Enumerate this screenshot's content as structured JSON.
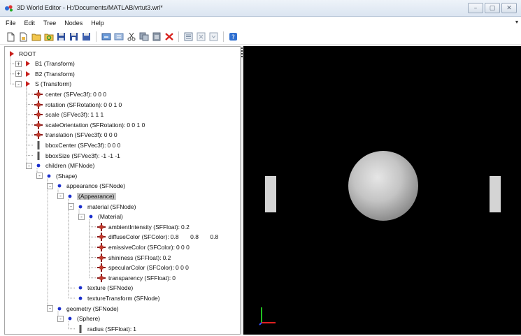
{
  "window": {
    "title": "3D World Editor - H:/Documents/MATLAB/vrtut3.wrl*",
    "controls": [
      "minimize",
      "maximize",
      "close"
    ]
  },
  "menu": [
    "File",
    "Edit",
    "Tree",
    "Nodes",
    "Help"
  ],
  "toolbar": {
    "buttons": [
      "new-file-icon",
      "open-file-icon",
      "open-folder-icon",
      "reload-icon",
      "save-icon",
      "save-as-icon",
      "save-copy-icon",
      "undo-icon",
      "redo-icon",
      "cut-icon",
      "copy-icon",
      "paste-icon",
      "delete-icon",
      "expand-icon",
      "collapse-icon",
      "collapse-all-icon",
      "help-icon"
    ]
  },
  "tree": {
    "rows": [
      {
        "label": "ROOT",
        "value": "",
        "kind": "root",
        "depth": 0,
        "expander": "",
        "selected": false
      },
      {
        "label": "B1 (Transform)",
        "value": "",
        "kind": "node",
        "depth": 1,
        "expander": "+",
        "selected": false
      },
      {
        "label": "B2 (Transform)",
        "value": "",
        "kind": "node",
        "depth": 1,
        "expander": "+",
        "selected": false
      },
      {
        "label": "S (Transform)",
        "value": "",
        "kind": "node",
        "depth": 1,
        "expander": "-",
        "selected": false
      },
      {
        "label": "center (SFVec3f):",
        "value": "0 0 0",
        "kind": "field",
        "depth": 2,
        "expander": "",
        "selected": false
      },
      {
        "label": "rotation (SFRotation):",
        "value": "0 0 1 0",
        "kind": "field",
        "depth": 2,
        "expander": "",
        "selected": false
      },
      {
        "label": "scale (SFVec3f):",
        "value": "1 1 1",
        "kind": "field",
        "depth": 2,
        "expander": "",
        "selected": false
      },
      {
        "label": "scaleOrientation (SFRotation):",
        "value": "0 0 1 0",
        "kind": "field",
        "depth": 2,
        "expander": "",
        "selected": false
      },
      {
        "label": "translation (SFVec3f):",
        "value": "0 0 0",
        "kind": "field",
        "depth": 2,
        "expander": "",
        "selected": false
      },
      {
        "label": "bboxCenter (SFVec3f):",
        "value": "0 0 0",
        "kind": "bbox",
        "depth": 2,
        "expander": "",
        "selected": false
      },
      {
        "label": "bboxSize (SFVec3f):",
        "value": "-1 -1 -1",
        "kind": "bbox",
        "depth": 2,
        "expander": "",
        "selected": false
      },
      {
        "label": "children (MFNode)",
        "value": "",
        "kind": "slot",
        "depth": 2,
        "expander": "-",
        "selected": false
      },
      {
        "label": "(Shape)",
        "value": "",
        "kind": "slot",
        "depth": 3,
        "expander": "-",
        "selected": false
      },
      {
        "label": "appearance (SFNode)",
        "value": "",
        "kind": "slot",
        "depth": 4,
        "expander": "-",
        "selected": false
      },
      {
        "label": "(Appearance)",
        "value": "",
        "kind": "slot",
        "depth": 5,
        "expander": "-",
        "selected": true
      },
      {
        "label": "material (SFNode)",
        "value": "",
        "kind": "slot",
        "depth": 6,
        "expander": "-",
        "selected": false
      },
      {
        "label": "(Material)",
        "value": "",
        "kind": "slot",
        "depth": 7,
        "expander": "-",
        "selected": false
      },
      {
        "label": "ambientIntensity (SFFloat):",
        "value": "0.2",
        "kind": "field",
        "depth": 8,
        "expander": "",
        "selected": false
      },
      {
        "label": "diffuseColor (SFColor):",
        "value": "0.8       0.8       0.8",
        "kind": "field",
        "depth": 8,
        "expander": "",
        "selected": false
      },
      {
        "label": "emissiveColor (SFColor):",
        "value": "0 0 0",
        "kind": "field",
        "depth": 8,
        "expander": "",
        "selected": false
      },
      {
        "label": "shininess (SFFloat):",
        "value": "0.2",
        "kind": "field",
        "depth": 8,
        "expander": "",
        "selected": false
      },
      {
        "label": "specularColor (SFColor):",
        "value": "0 0 0",
        "kind": "field",
        "depth": 8,
        "expander": "",
        "selected": false
      },
      {
        "label": "transparency (SFFloat):",
        "value": "0",
        "kind": "field",
        "depth": 8,
        "expander": "",
        "selected": false
      },
      {
        "label": "texture (SFNode)",
        "value": "",
        "kind": "slot",
        "depth": 6,
        "expander": "",
        "selected": false
      },
      {
        "label": "textureTransform (SFNode)",
        "value": "",
        "kind": "slot",
        "depth": 6,
        "expander": "",
        "selected": false
      },
      {
        "label": "geometry (SFNode)",
        "value": "",
        "kind": "slot",
        "depth": 4,
        "expander": "-",
        "selected": false
      },
      {
        "label": "(Sphere)",
        "value": "",
        "kind": "slot",
        "depth": 5,
        "expander": "-",
        "selected": false
      },
      {
        "label": "radius (SFFloat):",
        "value": "1",
        "kind": "bbox",
        "depth": 6,
        "expander": "",
        "selected": false
      }
    ]
  },
  "viewer": {
    "background": "#000000",
    "objects": [
      {
        "name": "left-bar-B1",
        "shape": "box",
        "color": "#d4d4d4"
      },
      {
        "name": "center-sphere-S",
        "shape": "sphere",
        "color": "#cccccc"
      },
      {
        "name": "right-bar-B2",
        "shape": "box",
        "color": "#d4d4d4"
      }
    ],
    "axes": {
      "x_color": "#e02020",
      "y_color": "#20c020",
      "z_color": "#3050ff"
    }
  },
  "colors": {
    "node_arrow": "#c8201c",
    "field_icon": "#8b1a1a",
    "slot_dot": "#1a2ecc",
    "bbox_icon": "#555555",
    "selection": "#c6c6c6"
  }
}
